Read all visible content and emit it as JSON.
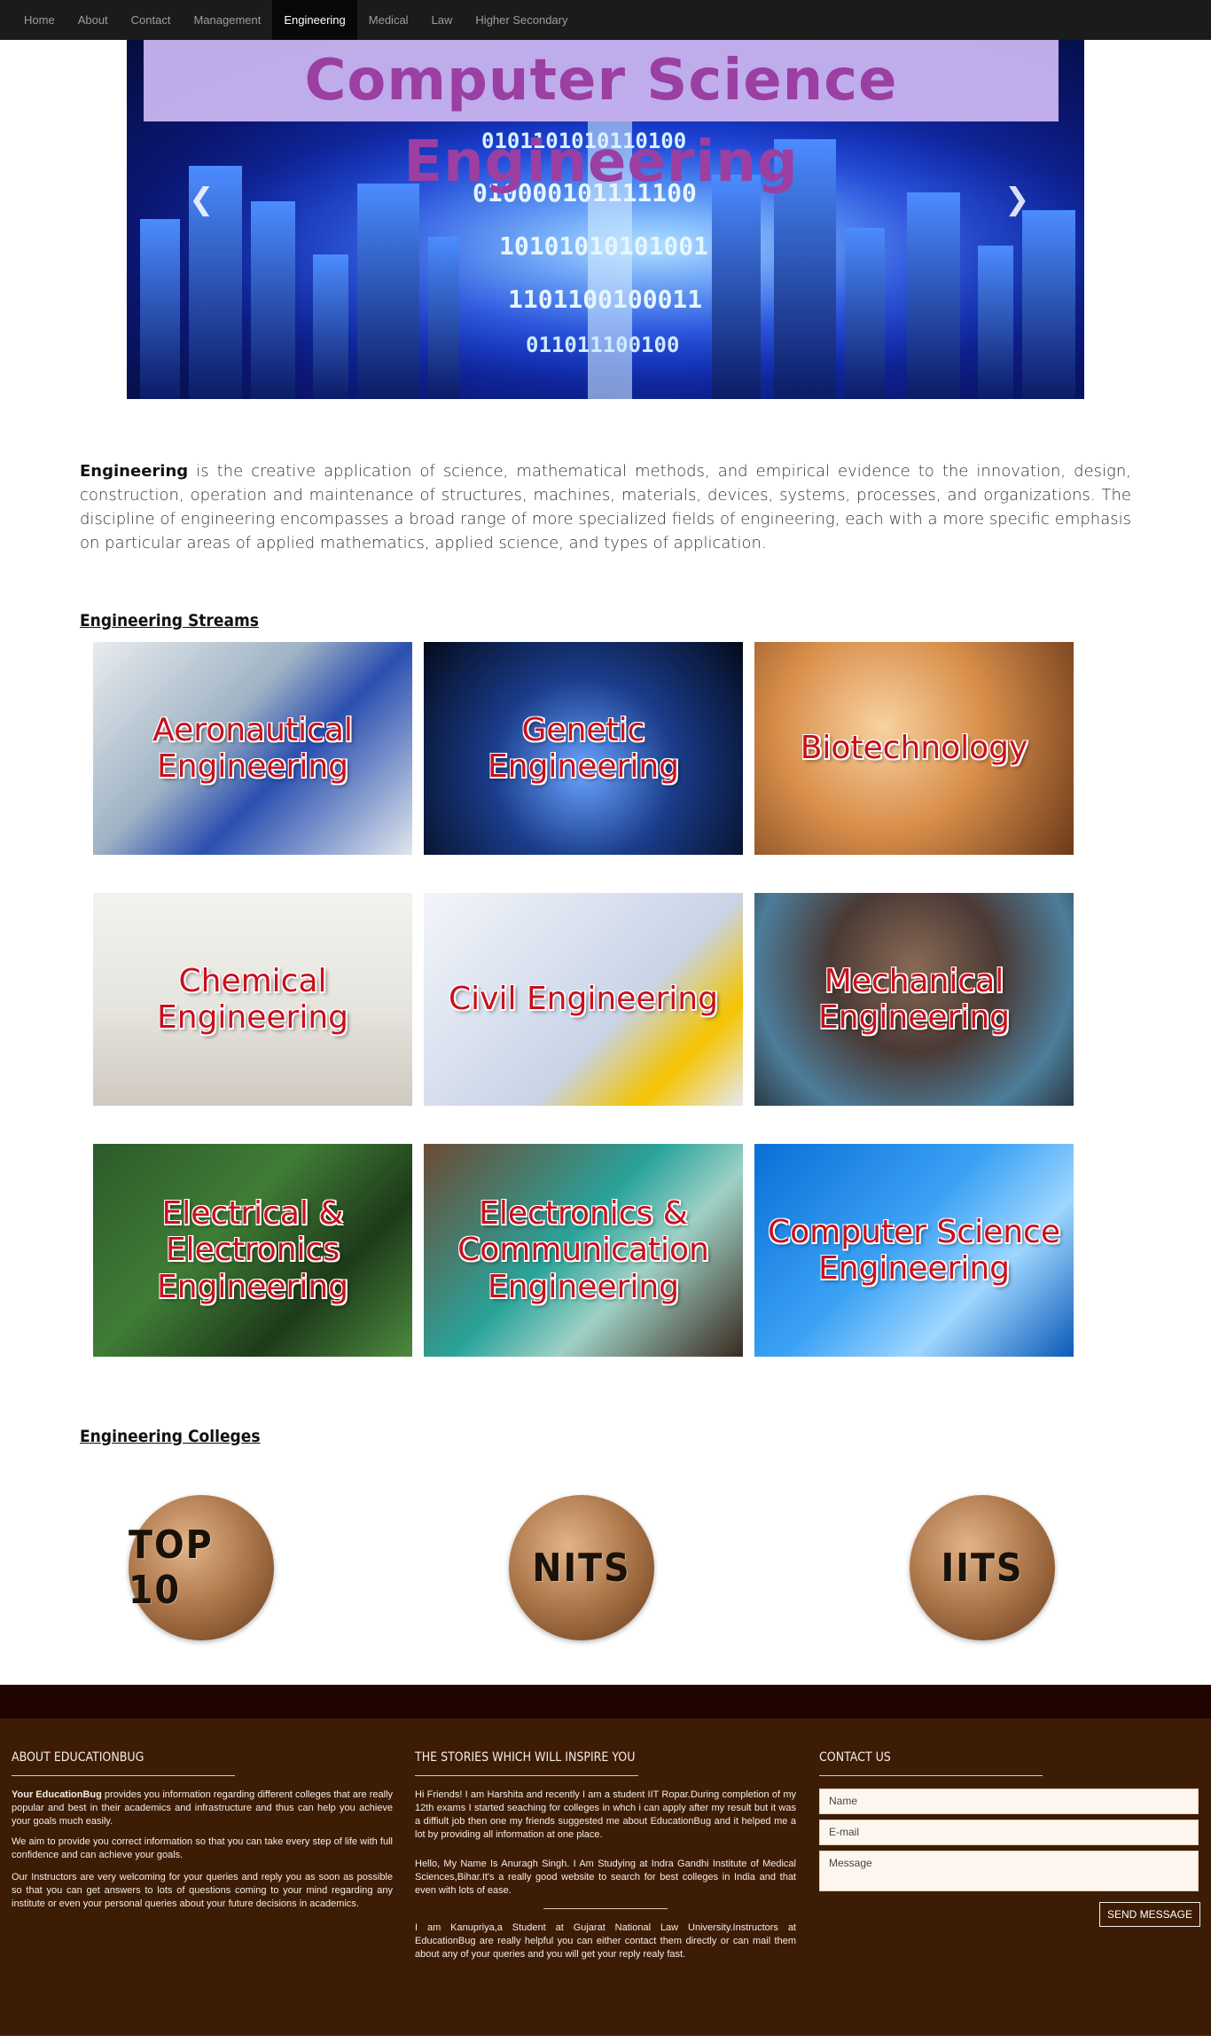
{
  "nav": {
    "items": [
      "Home",
      "About",
      "Contact",
      "Management",
      "Engineering",
      "Medical",
      "Law",
      "Higher Secondary"
    ],
    "active": "Engineering"
  },
  "hero": {
    "title": "Computer Science Engineering",
    "prev_icon": "chevron-left-icon",
    "next_icon": "chevron-right-icon"
  },
  "intro": {
    "lead": "Engineering",
    "text": " is the creative application of science, mathematical methods, and empirical evidence to the innovation, design, construction, operation and maintenance of structures, machines, materials, devices, systems, processes, and organizations. The discipline of engineering encompasses a broad range of more specialized fields of engineering, each with a more specific emphasis on particular areas of applied mathematics, applied science, and types of application."
  },
  "streams": {
    "heading": "Engineering Streams",
    "cards": [
      "Aeronautical Engineering",
      "Genetic Engineering",
      "Biotechnology",
      "Chemical Engineering",
      "Civil Engineering",
      "Mechanical Engineering",
      "Electrical & Electronics Engineering",
      "Electronics & Communication Engineering",
      "Computer Science Engineering"
    ]
  },
  "colleges": {
    "heading": "Engineering Colleges",
    "items": [
      "TOP 10",
      "NITS",
      "IITS"
    ]
  },
  "footer": {
    "about": {
      "heading": "ABOUT EDUCATIONBUG",
      "lead": "Your EducationBug",
      "p1": " provides you information regarding different colleges that are really popular and best in their academics and infrastructure and thus can help you achieve your goals much easily.",
      "p2": "We aim to provide you correct information so that you can take every step of life with full confidence and can achieve your goals.",
      "p3": "Our Instructors are very welcoming for your queries and reply you as soon as possible so that you can get answers to lots of questions coming to your mind regarding any institute or even your personal queries about your future decisions in academics."
    },
    "stories": {
      "heading": "THE STORIES WHICH WILL INSPIRE YOU",
      "s1": "Hi Friends! I am Harshita and recently I am a student IIT Ropar.During completion of my 12th exams I started seaching for colleges in whch i can apply after my result but it was a diffiult job then one my friends suggested me about EducationBug and it helped me a lot by providing all information at one place.",
      "s2": "Hello, My Name Is Anuragh Singh. I Am Studying at Indra Gandhi Institute of Medical Sciences,Bihar.It's a really good website to search for best colleges in India and that even with lots of ease.",
      "s3": "I am Kanupriya,a Student at Gujarat National Law University.Instructors at EducationBug are really helpful you can either contact them directly or can mail them about any of your queries and you will get your reply realy fast."
    },
    "contact": {
      "heading": "CONTACT US",
      "name_placeholder": "Name",
      "email_placeholder": "E-mail",
      "message_placeholder": "Message",
      "send_label": "SEND MESSAGE"
    }
  }
}
